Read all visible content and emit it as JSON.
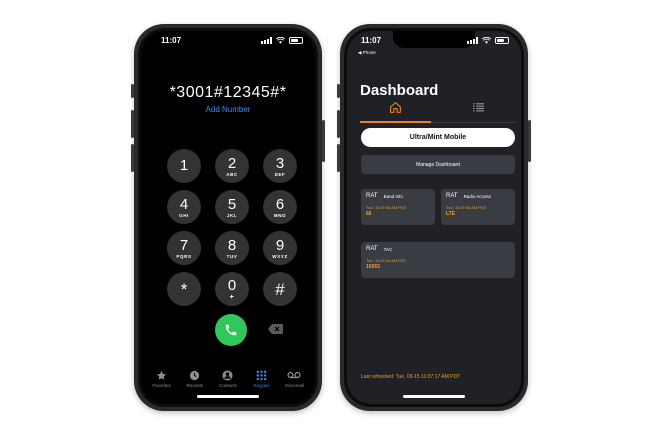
{
  "left_phone": {
    "status_time": "11:07",
    "dialed_number": "*3001#12345#*",
    "add_number": "Add Number",
    "keys": [
      {
        "digit": "1",
        "letters": ""
      },
      {
        "digit": "2",
        "letters": "ABC"
      },
      {
        "digit": "3",
        "letters": "DEF"
      },
      {
        "digit": "4",
        "letters": "GHI"
      },
      {
        "digit": "5",
        "letters": "JKL"
      },
      {
        "digit": "6",
        "letters": "MNO"
      },
      {
        "digit": "7",
        "letters": "PQRS"
      },
      {
        "digit": "8",
        "letters": "TUV"
      },
      {
        "digit": "9",
        "letters": "WXYZ"
      },
      {
        "digit": "*",
        "letters": ""
      },
      {
        "digit": "0",
        "letters": "+"
      },
      {
        "digit": "#",
        "letters": ""
      }
    ],
    "tabs": [
      {
        "label": "Favorites",
        "icon": "star-icon"
      },
      {
        "label": "Recents",
        "icon": "clock-icon"
      },
      {
        "label": "Contacts",
        "icon": "person-icon"
      },
      {
        "label": "Keypad",
        "icon": "keypad-icon"
      },
      {
        "label": "Voicemail",
        "icon": "voicemail-icon"
      }
    ],
    "active_tab": "Keypad",
    "colors": {
      "accent": "#3a8ef6",
      "call": "#31c759",
      "key_bg": "#333335"
    }
  },
  "right_phone": {
    "status_time": "11:07",
    "back_label": "◀ Phone",
    "title": "Dashboard",
    "carrier_button": "Ultra/Mint Mobile",
    "manage_button": "Manage Dashboard",
    "cards": [
      {
        "rat": "RAT",
        "name": "Band Info",
        "time": "Tue, 11:07:04 AM PDT",
        "value": "66"
      },
      {
        "rat": "RAT",
        "name": "Radio Access",
        "time": "Tue, 11:07:04 AM PDT",
        "value": "LTE"
      },
      {
        "rat": "RAT",
        "name": "TAC",
        "time": "Tue, 11:07:04 AM PDT",
        "value": "16953"
      }
    ],
    "last_refreshed": "Last refreshed: Tue, 03-15 11:07:17 AM PDT",
    "colors": {
      "accent": "#f0801e",
      "value": "#f0a020",
      "background": "#1f2126",
      "card": "#3a3c44"
    }
  }
}
